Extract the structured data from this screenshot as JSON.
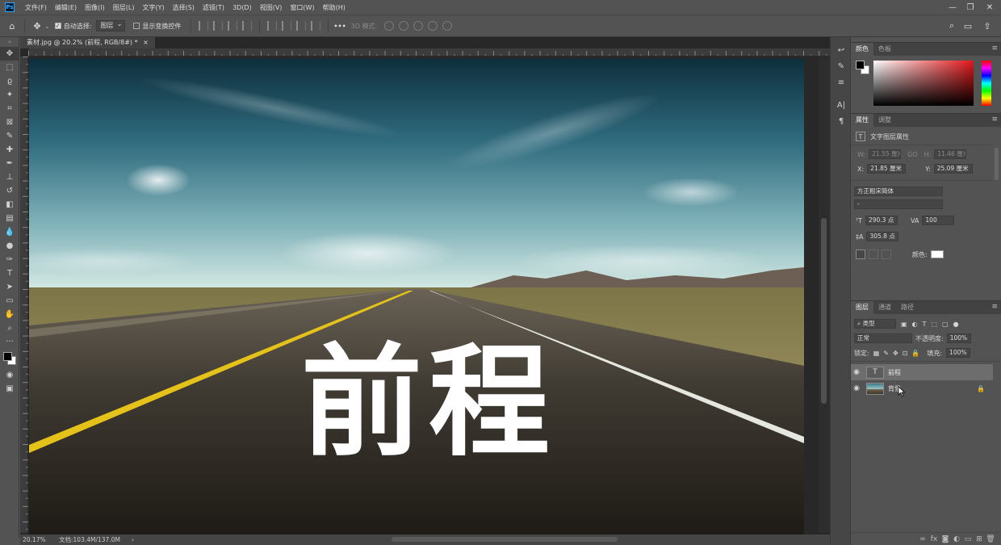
{
  "app": {
    "logo": "Ps"
  },
  "menu": [
    "文件(F)",
    "编辑(E)",
    "图像(I)",
    "图层(L)",
    "文字(Y)",
    "选择(S)",
    "滤镜(T)",
    "3D(D)",
    "视图(V)",
    "窗口(W)",
    "帮助(H)"
  ],
  "window_controls": {
    "minimize": "—",
    "restore": "❐",
    "close": "✕"
  },
  "options": {
    "auto_select_label": "自动选择:",
    "auto_select_value": "图层",
    "transform_label": "显示变换控件",
    "more": "•••",
    "mode_3d_label": "3D 模式:"
  },
  "right_icons": {
    "search": "⌕",
    "workspace": "▭",
    "share": "⇪"
  },
  "document": {
    "tab_title": "素材.jpg @ 20.2% (前程, RGB/8#) *",
    "close": "×",
    "canvas_text": "前程",
    "zoom": "20.17%",
    "doc_info": "文档:103.4M/137.0M",
    "status_arrow": "›"
  },
  "color_panel": {
    "tabs": [
      "颜色",
      "色板"
    ]
  },
  "properties_panel": {
    "tabs": [
      "属性",
      "调整"
    ],
    "header": "文字图层属性",
    "w_label": "W:",
    "w_value": "21.55 厘米",
    "go": "GO",
    "h_label": "H:",
    "h_value": "11.46 厘米",
    "x_label": "X:",
    "x_value": "21.85 厘米",
    "y_label": "Y:",
    "y_value": "25.09 厘米",
    "font_family": "方正粗宋简体",
    "font_style": "-",
    "font_size": "290.3 点",
    "tracking": "100",
    "leading": "305.8 点",
    "color_label": "颜色:"
  },
  "layers_panel": {
    "tabs": [
      "图层",
      "通道",
      "路径"
    ],
    "filter": "类型",
    "blend_mode": "正常",
    "opacity_label": "不透明度:",
    "opacity_value": "100%",
    "lock_label": "锁定:",
    "fill_label": "填充:",
    "fill_value": "100%",
    "layers": [
      {
        "name": "前程",
        "type": "text",
        "selected": true
      },
      {
        "name": "背景",
        "type": "image",
        "locked": true
      }
    ]
  },
  "colors": {
    "accent": "#31a8ff",
    "panel_bg": "#535353",
    "canvas_text": "#ffffff",
    "road_line": "#e4c21a"
  }
}
